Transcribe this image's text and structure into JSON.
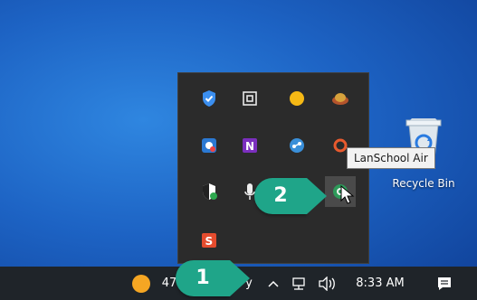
{
  "desktop": {
    "recycle_bin_label": "Recycle Bin"
  },
  "tray_flyout": {
    "tooltip": "LanSchool Air",
    "icons": [
      "defender-shield-icon",
      "windows-app-icon",
      "yellow-circle-icon",
      "brown-hat-icon",
      "blue-record-icon",
      "onenote-icon",
      "blue-share-icon",
      "red-circle-icon",
      "windows-security-icon",
      "microphone-icon",
      "lanschool-air-icon",
      "sogou-s-icon"
    ]
  },
  "callouts": {
    "step1": "1",
    "step2": "2"
  },
  "taskbar": {
    "weather_temp": "47",
    "weather_text": "y",
    "time": "8:33 AM"
  },
  "colors": {
    "callout": "#1fa589",
    "taskbar": "#1f2429",
    "flyout": "#2b2b2b"
  }
}
